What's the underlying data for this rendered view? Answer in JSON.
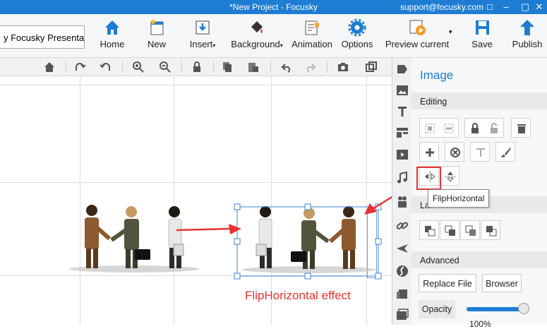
{
  "window": {
    "title": "*New Project - Focusky",
    "support": "support@focusky.com"
  },
  "ribbon": {
    "project_name": "y Focusky Presenta",
    "buttons": [
      {
        "label": "Home",
        "icon": "home-icon"
      },
      {
        "label": "New",
        "icon": "new-icon"
      },
      {
        "label": "Insert",
        "icon": "insert-icon"
      },
      {
        "label": "Background",
        "icon": "background-icon"
      },
      {
        "label": "Animation",
        "icon": "animation-icon"
      },
      {
        "label": "Options",
        "icon": "gear-icon"
      },
      {
        "label": "Preview current",
        "icon": "preview-icon"
      },
      {
        "label": "Save",
        "icon": "save-icon"
      },
      {
        "label": "Publish",
        "icon": "publish-icon"
      }
    ]
  },
  "canvas": {
    "effect_label": "FlipHorizontal effect"
  },
  "panel": {
    "title": "Image",
    "sections": {
      "editing": "Editing",
      "layer": "La",
      "advanced": "Advanced"
    },
    "tooltip": "FlipHorizontal",
    "advanced": {
      "replace_file": "Replace File",
      "browser": "Browser",
      "opacity_label": "Opacity",
      "opacity_value": "100%",
      "opacity_fraction": 1.0
    }
  },
  "colors": {
    "accent": "#1e7dd3",
    "annotation": "#e83232"
  }
}
